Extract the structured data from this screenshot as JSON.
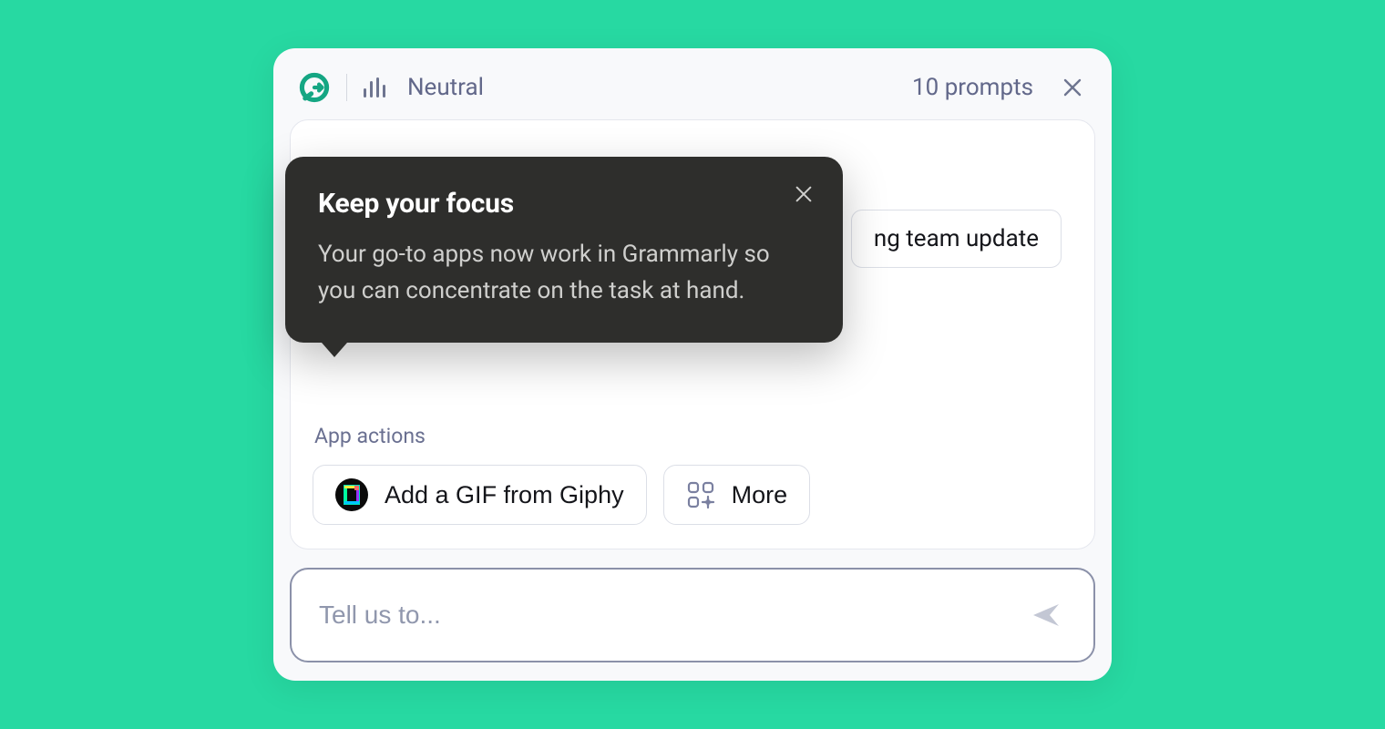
{
  "header": {
    "tone": "Neutral",
    "prompts": "10 prompts"
  },
  "suggestion": {
    "partial_label": "ng team update"
  },
  "section_label": "App actions",
  "actions": {
    "giphy_label": "Add a GIF from Giphy",
    "more_label": "More"
  },
  "input": {
    "placeholder": "Tell us to..."
  },
  "tooltip": {
    "title": "Keep your focus",
    "body": "Your go-to apps now work in Grammarly so you can concentrate on the task at hand."
  }
}
